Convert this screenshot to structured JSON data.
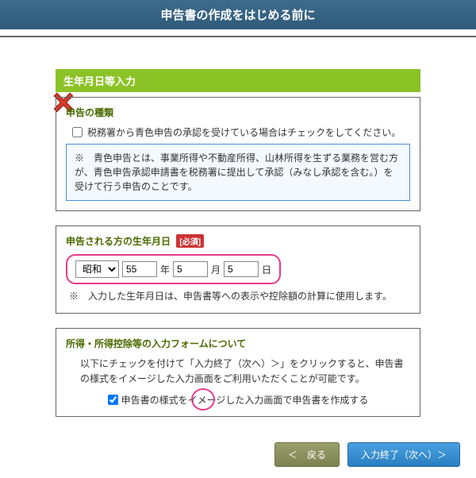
{
  "header": {
    "title": "申告書の作成をはじめる前に"
  },
  "section1": {
    "heading": "生年月日等入力"
  },
  "panel1": {
    "sub_head": "申告の種類",
    "check_label": "税務署から青色申告の承認を受けている場合はチェックをしてください。",
    "info_prefix": "※　",
    "info_text": "青色申告とは、事業所得や不動産所得、山林所得を生ずる業務を営む方が、青色申告承認申請書を税務署に提出して承認（みなし承認を含む。）を受けて行う申告のことです。"
  },
  "panel2": {
    "sub_head": "申告される方の生年月日",
    "required": "[必須]",
    "era_options": [
      "昭和"
    ],
    "era_selected": "昭和",
    "year_value": "55",
    "year_label": "年",
    "month_value": "5",
    "month_label": "月",
    "day_value": "5",
    "day_label": "日",
    "note_prefix": "※　",
    "note": "入力した生年月日は、申告書等への表示や控除額の計算に使用します。"
  },
  "panel3": {
    "sub_head": "所得・所得控除等の入力フォームについて",
    "desc": "以下にチェックを付けて「入力終了（次へ）＞」をクリックすると、申告書の様式をイメージした入力画面をご利用いただくことが可能です。",
    "check_label": "申告書の様式をイメージした入力画面で申告書を作成する",
    "checked": true
  },
  "buttons": {
    "back": "＜　戻る",
    "next": "入力終了（次へ）＞"
  }
}
